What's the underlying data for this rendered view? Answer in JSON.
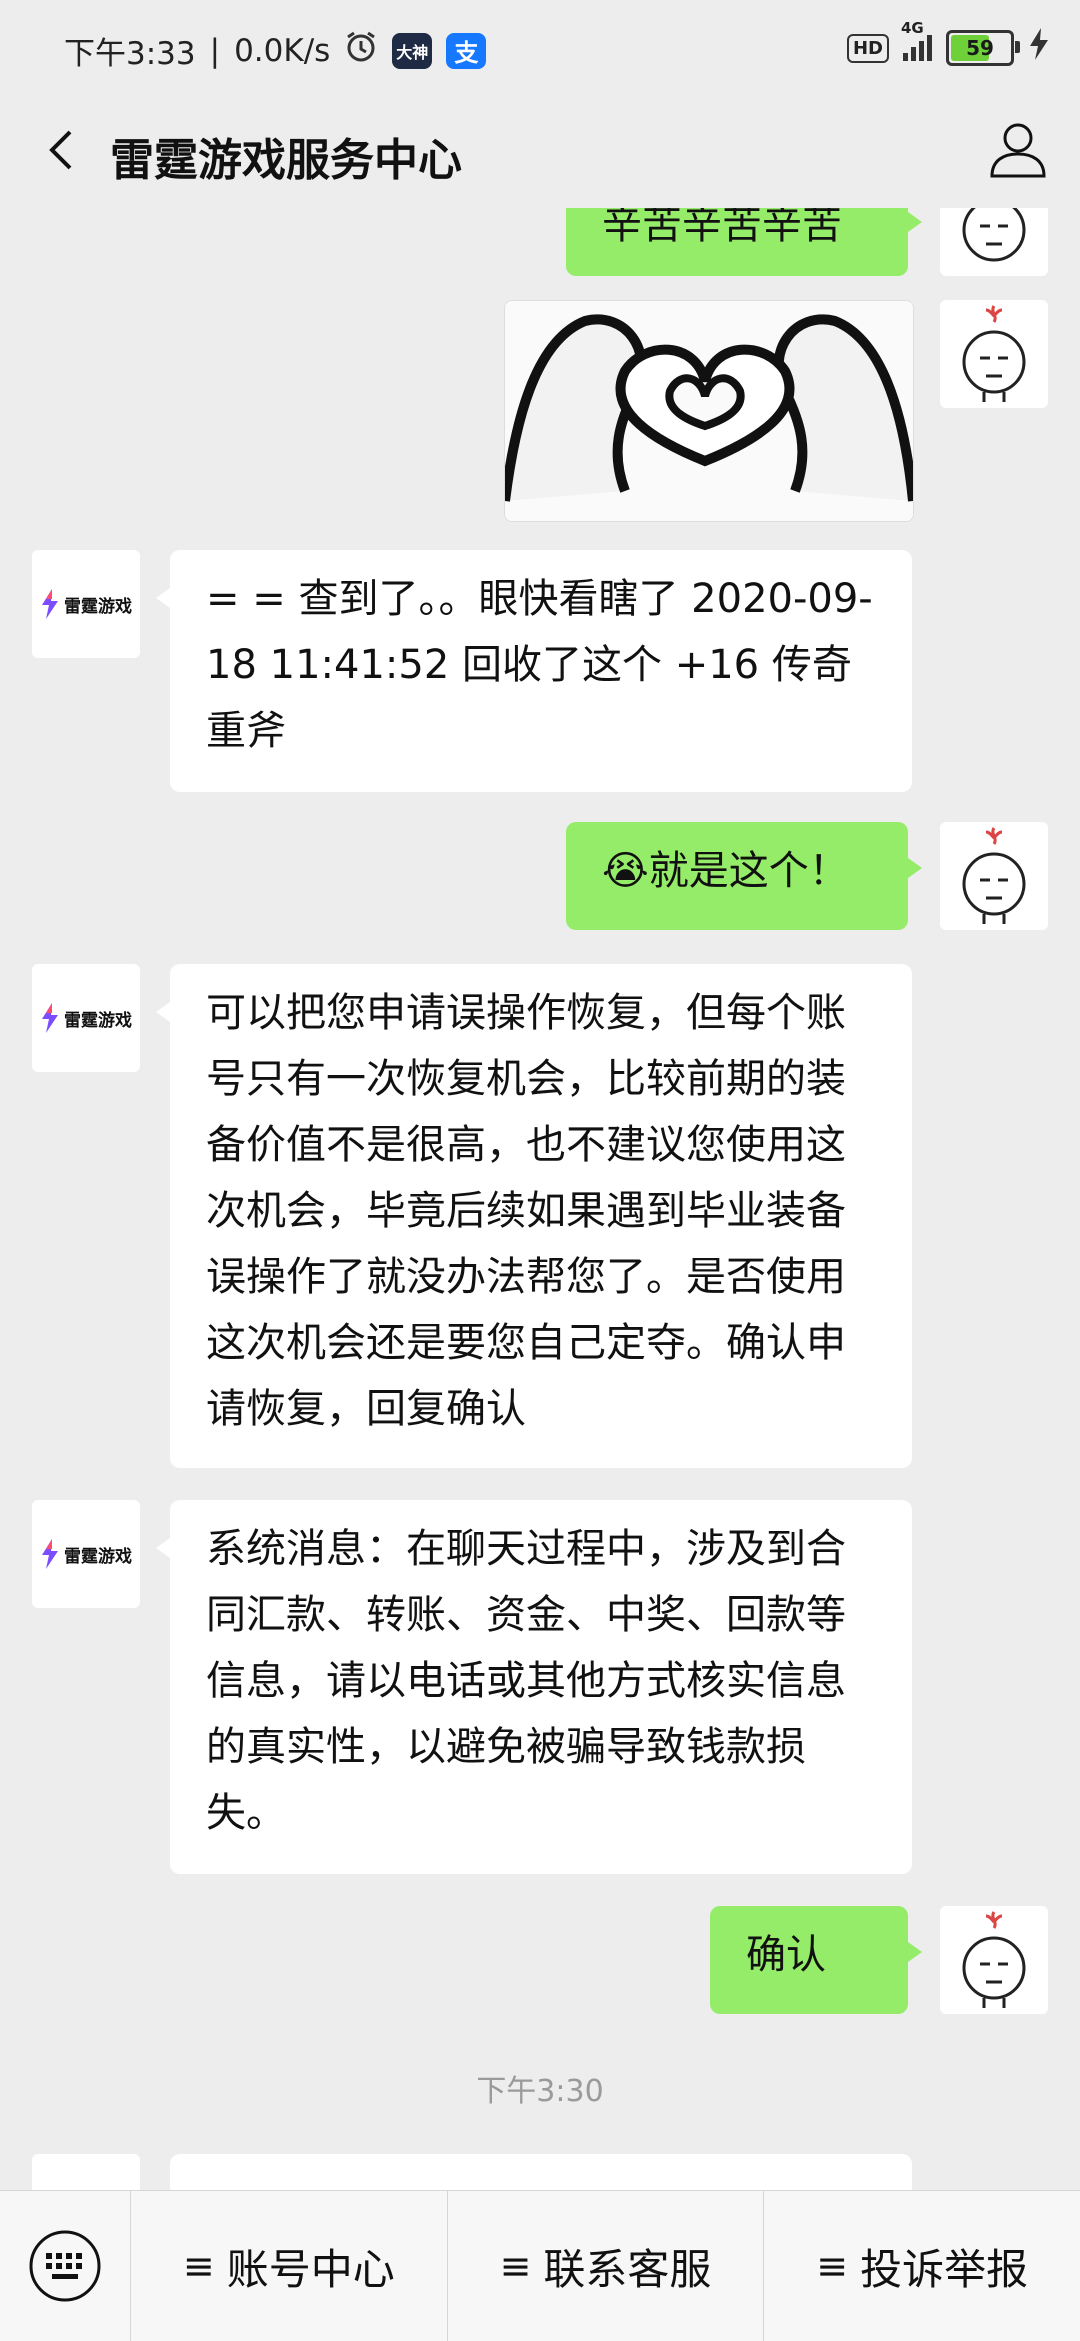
{
  "status_bar": {
    "time": "下午3:33",
    "speed": "0.0K/s",
    "hd": "HD",
    "network": "4G",
    "battery": "59",
    "app_badge_1": "大神",
    "app_badge_2": "支"
  },
  "nav": {
    "title": "雷霆游戏服务中心"
  },
  "bot": {
    "logo_text": "雷霆游戏"
  },
  "messages": [
    {
      "sender": "me",
      "type": "text",
      "text": "辛苦辛苦辛苦"
    },
    {
      "sender": "me",
      "type": "sticker",
      "description": "heart-hands-sticker"
    },
    {
      "sender": "bot",
      "type": "text",
      "text": "= = 查到了。。眼快看瞎了 2020-09-18 11:41:52 回收了这个 +16 传奇重斧"
    },
    {
      "sender": "me",
      "type": "text",
      "emoji": "😭",
      "text": "就是这个！"
    },
    {
      "sender": "bot",
      "type": "text",
      "text": "可以把您申请误操作恢复，但每个账号只有一次恢复机会，比较前期的装备价值不是很高，也不建议您使用这次机会，毕竟后续如果遇到毕业装备误操作了就没办法帮您了。是否使用这次机会还是要您自己定夺。确认申请恢复，回复确认"
    },
    {
      "sender": "bot",
      "type": "text",
      "text": "系统消息：在聊天过程中，涉及到合同汇款、转账、资金、中奖、回款等信息，请以电话或其他方式核实信息的真实性，以避免被骗导致钱款损失。"
    },
    {
      "sender": "me",
      "type": "text",
      "text": "确认"
    }
  ],
  "timestamp": "下午3:30",
  "menu": {
    "items": [
      "账号中心",
      "联系客服",
      "投诉举报"
    ],
    "lines_glyph": "≡"
  },
  "colors": {
    "my_bubble": "#95ec69",
    "bot_bubble": "#ffffff",
    "background": "#ededed"
  }
}
